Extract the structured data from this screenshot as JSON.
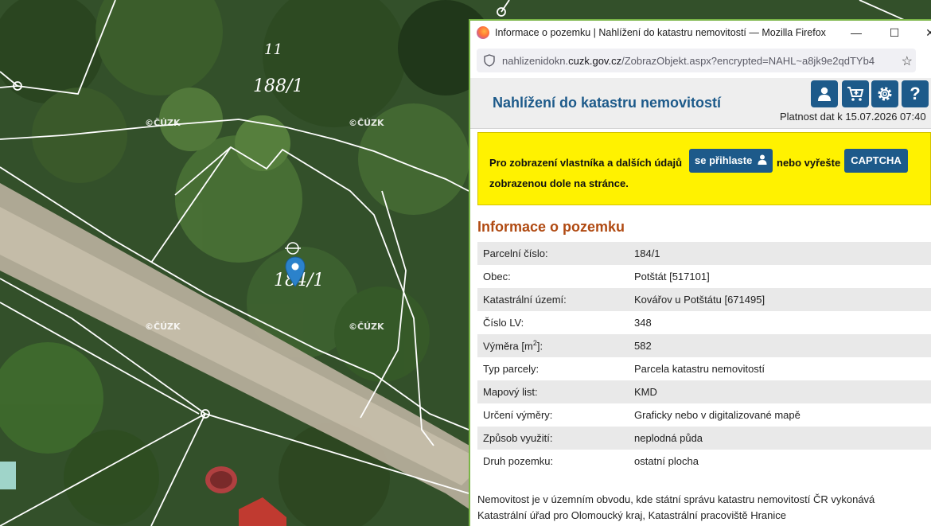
{
  "map": {
    "watermarks": [
      "©ČÚZK",
      "©ČÚZK",
      "©ČÚZK",
      "©ČÚZK"
    ],
    "parcel_labels": [
      "11",
      "188/1",
      "184/1"
    ]
  },
  "browser": {
    "window_title": "Informace o pozemku | Nahlížení do katastru nemovitostí — Mozilla Firefox",
    "url_prefix": "nahlizenidokn.",
    "url_domain": "cuzk.gov.cz",
    "url_path": "/ZobrazObjekt.aspx?encrypted=NAHL~a8jk9e2qdTYb4",
    "minimize": "—",
    "maximize": "☐",
    "close": "✕"
  },
  "app": {
    "title": "Nahlížení do katastru nemovitostí",
    "validity": "Platnost dat k 15.07.2026 07:40",
    "header_icons": [
      "user-icon",
      "cart-icon",
      "settings-icon",
      "help-icon"
    ]
  },
  "notice": {
    "text_before": "Pro zobrazení vlastníka a dalších údajů",
    "login_button": "se přihlaste",
    "text_middle": "nebo vyřešte",
    "captcha_button": "CAPTCHA",
    "text_after": "zobrazenou dole na stránce."
  },
  "section_title": "Informace o pozemku",
  "parcel_info": {
    "rows": [
      {
        "label": "Parcelní číslo:",
        "value": "184/1"
      },
      {
        "label": "Obec:",
        "value": "Potštát [517101]"
      },
      {
        "label": "Katastrální území:",
        "value": "Kovářov u Potštátu [671495]"
      },
      {
        "label": "Číslo LV:",
        "value": "348"
      },
      {
        "label_prefix": "Výměra [m",
        "label_sup": "2",
        "label_suffix": "]:",
        "value": "582"
      },
      {
        "label": "Typ parcely:",
        "value": "Parcela katastru nemovitostí"
      },
      {
        "label": "Mapový list:",
        "value": "KMD"
      },
      {
        "label": "Určení výměry:",
        "value": "Graficky nebo v digitalizované mapě"
      },
      {
        "label": "Způsob využití:",
        "value": "neplodná půda"
      },
      {
        "label": "Druh pozemku:",
        "value": "ostatní plocha"
      }
    ]
  },
  "footer": {
    "line1": "Nemovitost je v územním obvodu, kde státní správu katastru nemovitostí ČR vykonává",
    "line2": "Katastrální úřad pro Olomoucký kraj, Katastrální pracoviště Hranice"
  }
}
